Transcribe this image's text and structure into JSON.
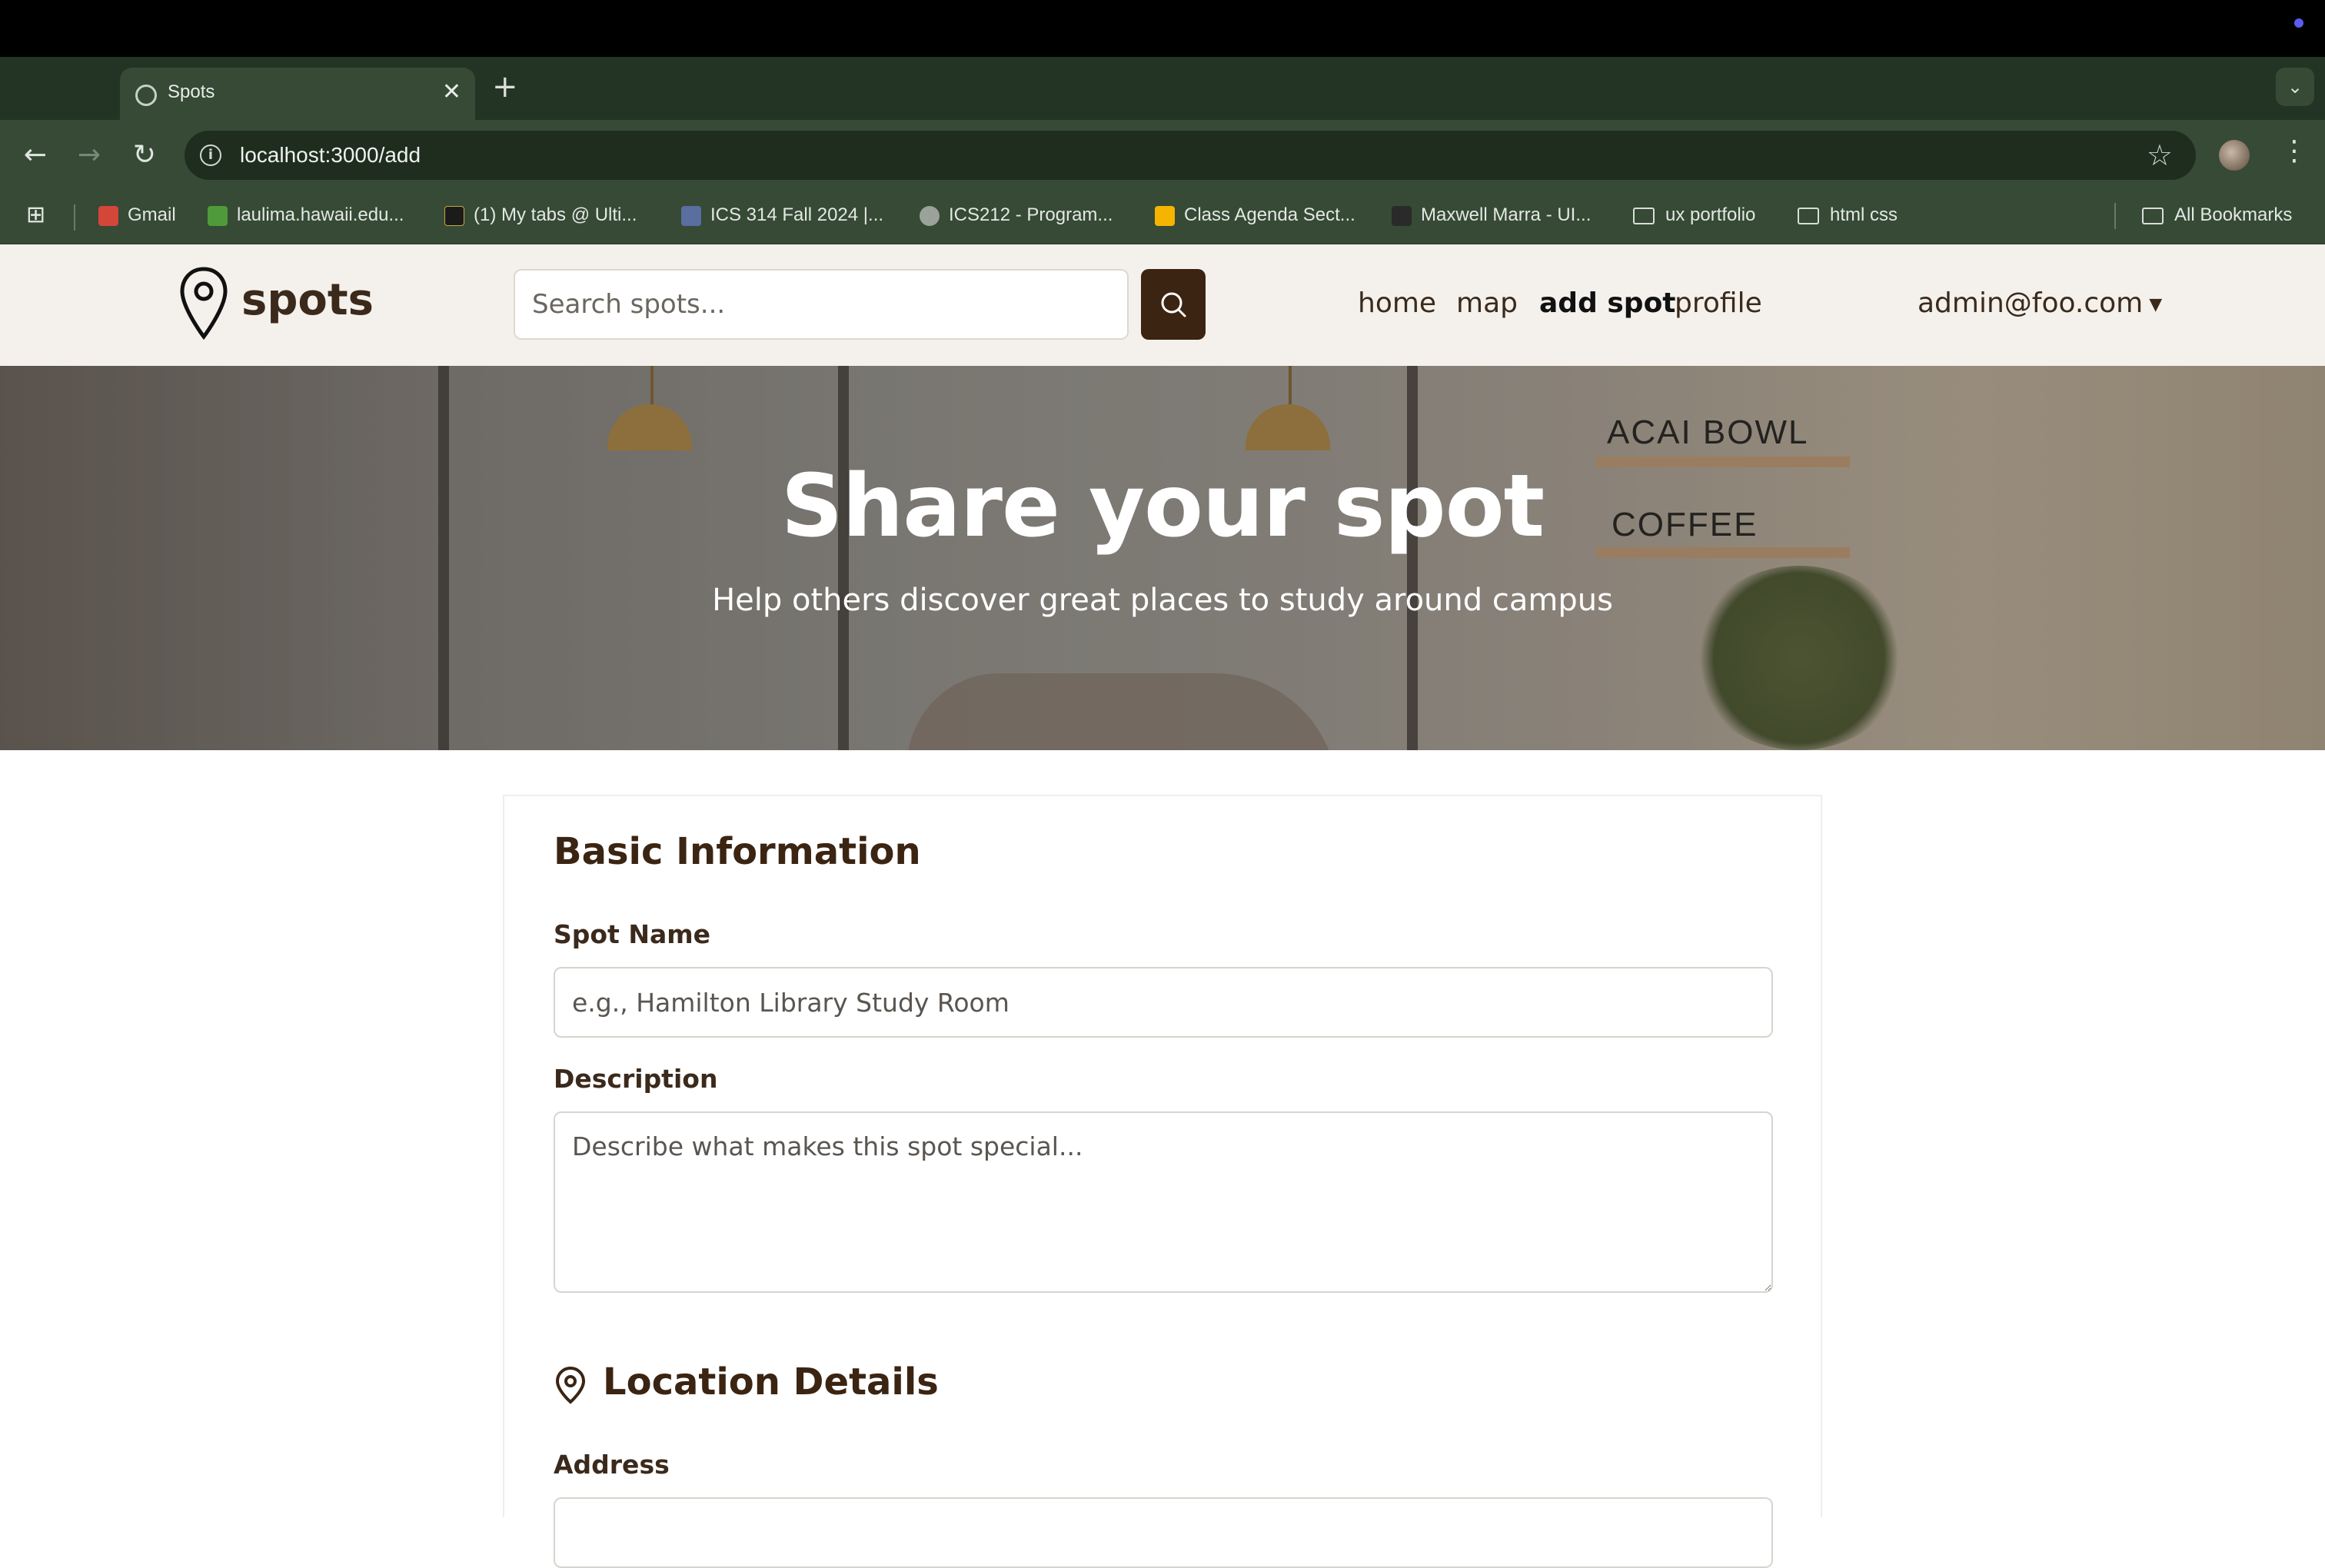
{
  "browser": {
    "tab_title": "Spots",
    "tab_close": "✕",
    "new_tab": "+",
    "tab_search_icon": "chevron-down-icon",
    "url": "localhost:3000/add",
    "bookmarks": [
      {
        "label": "Gmail",
        "icon": "gmail-icon",
        "color": "#d44638"
      },
      {
        "label": "laulima.hawaii.edu...",
        "icon": "leaf-icon",
        "color": "#4f9a3a"
      },
      {
        "label": "(1) My tabs @ Ulti...",
        "icon": "ug-icon",
        "color": "#1b1b1b"
      },
      {
        "label": "ICS 314 Fall 2024 |...",
        "icon": "square-icon",
        "color": "#5a6ea0"
      },
      {
        "label": "ICS212 - Program...",
        "icon": "globe-icon",
        "color": "#9aa29a"
      },
      {
        "label": "Class Agenda Sect...",
        "icon": "slides-icon",
        "color": "#f4b400"
      },
      {
        "label": "Maxwell Marra - UI...",
        "icon": "medium-icon",
        "color": "#2a2a2a"
      },
      {
        "label": "ux portfolio",
        "icon": "folder-icon"
      },
      {
        "label": "html css",
        "icon": "folder-icon"
      }
    ],
    "all_bookmarks": "All Bookmarks"
  },
  "site": {
    "logo_text": "spots",
    "search_placeholder": "Search spots...",
    "nav": [
      "home",
      "map",
      "add spot",
      "profile"
    ],
    "active_nav": "add spot",
    "user": "admin@foo.com",
    "brand_color": "#3b2412"
  },
  "hero": {
    "title": "Share your spot",
    "subtitle": "Help others discover great places to study around campus",
    "shelf_labels": [
      "ACAI BOWL",
      "COFFEE"
    ]
  },
  "form": {
    "basic_title": "Basic Information",
    "spot_name_label": "Spot Name",
    "spot_name_placeholder": "e.g., Hamilton Library Study Room",
    "description_label": "Description",
    "description_placeholder": "Describe what makes this spot special...",
    "location_title": "Location Details",
    "address_label": "Address"
  }
}
